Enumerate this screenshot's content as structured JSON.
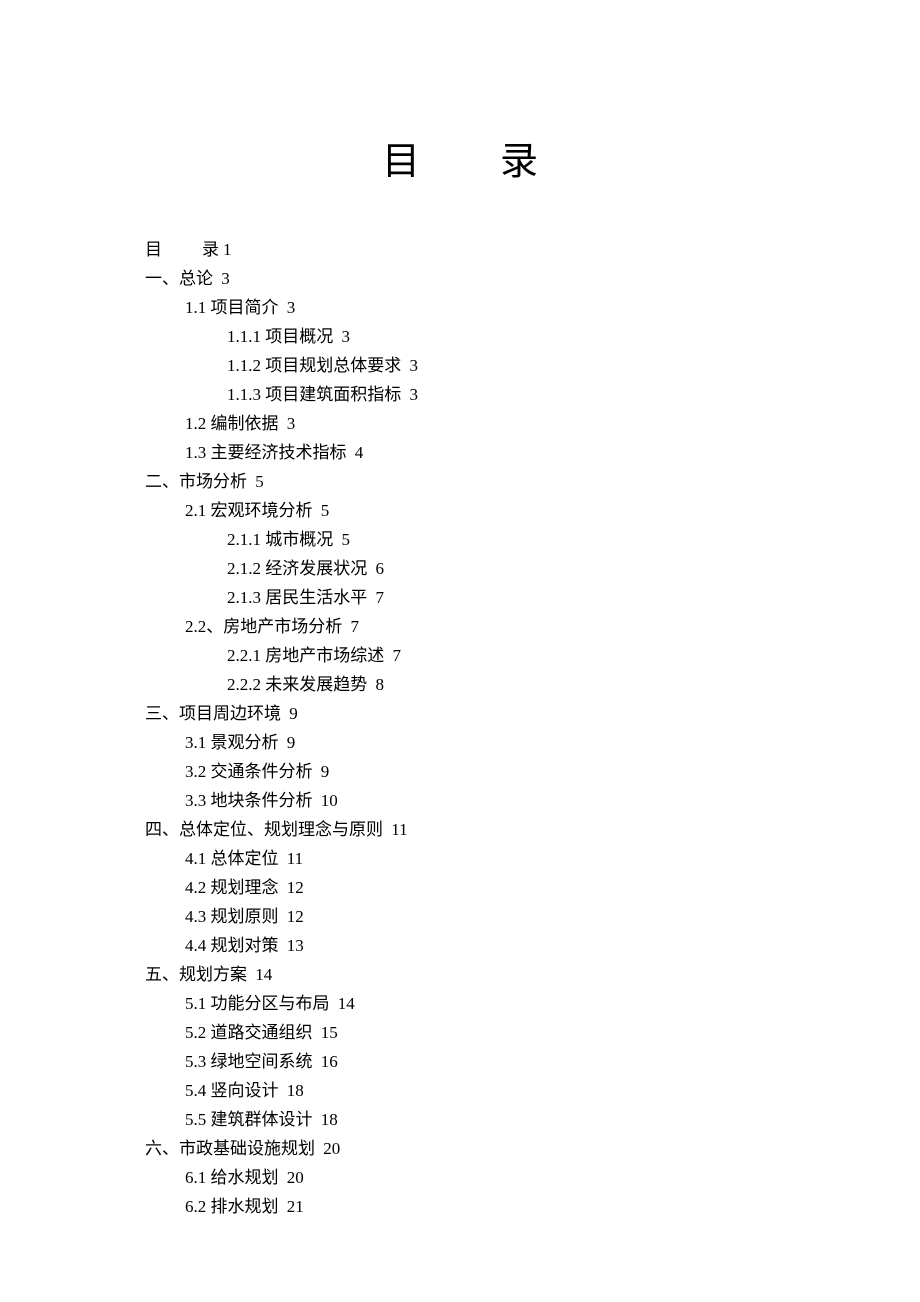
{
  "title_left": "目",
  "title_right": "录",
  "toc": {
    "root_label": "目",
    "root_label2": "录",
    "root_page": "1",
    "entries": [
      {
        "level": 0,
        "label": "一、总论",
        "page": "3"
      },
      {
        "level": 1,
        "label": "1.1 项目简介",
        "page": "3"
      },
      {
        "level": 2,
        "label": "1.1.1 项目概况",
        "page": "3"
      },
      {
        "level": 2,
        "label": "1.1.2 项目规划总体要求",
        "page": "3"
      },
      {
        "level": 2,
        "label": "1.1.3 项目建筑面积指标",
        "page": "3"
      },
      {
        "level": 1,
        "label": "1.2 编制依据",
        "page": "3"
      },
      {
        "level": 1,
        "label": "1.3 主要经济技术指标",
        "page": "4"
      },
      {
        "level": 0,
        "label": "二、市场分析",
        "page": "5"
      },
      {
        "level": 1,
        "label": "2.1 宏观环境分析",
        "page": "5"
      },
      {
        "level": 2,
        "label": "2.1.1 城市概况",
        "page": "5"
      },
      {
        "level": 2,
        "label": "2.1.2 经济发展状况",
        "page": "6"
      },
      {
        "level": 2,
        "label": "2.1.3 居民生活水平",
        "page": "7"
      },
      {
        "level": 1,
        "label": "2.2、房地产市场分析",
        "page": "7"
      },
      {
        "level": 2,
        "label": "2.2.1 房地产市场综述",
        "page": "7"
      },
      {
        "level": 2,
        "label": "2.2.2 未来发展趋势",
        "page": "8"
      },
      {
        "level": 0,
        "label": "三、项目周边环境",
        "page": "9"
      },
      {
        "level": 1,
        "label": "3.1 景观分析",
        "page": "9"
      },
      {
        "level": 1,
        "label": "3.2 交通条件分析",
        "page": "9"
      },
      {
        "level": 1,
        "label": "3.3 地块条件分析",
        "page": "10"
      },
      {
        "level": 0,
        "label": "四、总体定位、规划理念与原则",
        "page": "11"
      },
      {
        "level": 1,
        "label": "4.1 总体定位",
        "page": "11"
      },
      {
        "level": 1,
        "label": "4.2 规划理念",
        "page": "12"
      },
      {
        "level": 1,
        "label": "4.3 规划原则",
        "page": "12"
      },
      {
        "level": 1,
        "label": "4.4 规划对策",
        "page": "13"
      },
      {
        "level": 0,
        "label": "五、规划方案",
        "page": "14"
      },
      {
        "level": 1,
        "label": "5.1 功能分区与布局",
        "page": "14"
      },
      {
        "level": 1,
        "label": "5.2 道路交通组织",
        "page": "15"
      },
      {
        "level": 1,
        "label": "5.3 绿地空间系统",
        "page": "16"
      },
      {
        "level": 1,
        "label": "5.4 竖向设计",
        "page": "18"
      },
      {
        "level": 1,
        "label": "5.5 建筑群体设计",
        "page": "18"
      },
      {
        "level": 0,
        "label": "六、市政基础设施规划",
        "page": "20"
      },
      {
        "level": 1,
        "label": "6.1 给水规划",
        "page": "20"
      },
      {
        "level": 1,
        "label": "6.2 排水规划",
        "page": "21"
      }
    ]
  }
}
